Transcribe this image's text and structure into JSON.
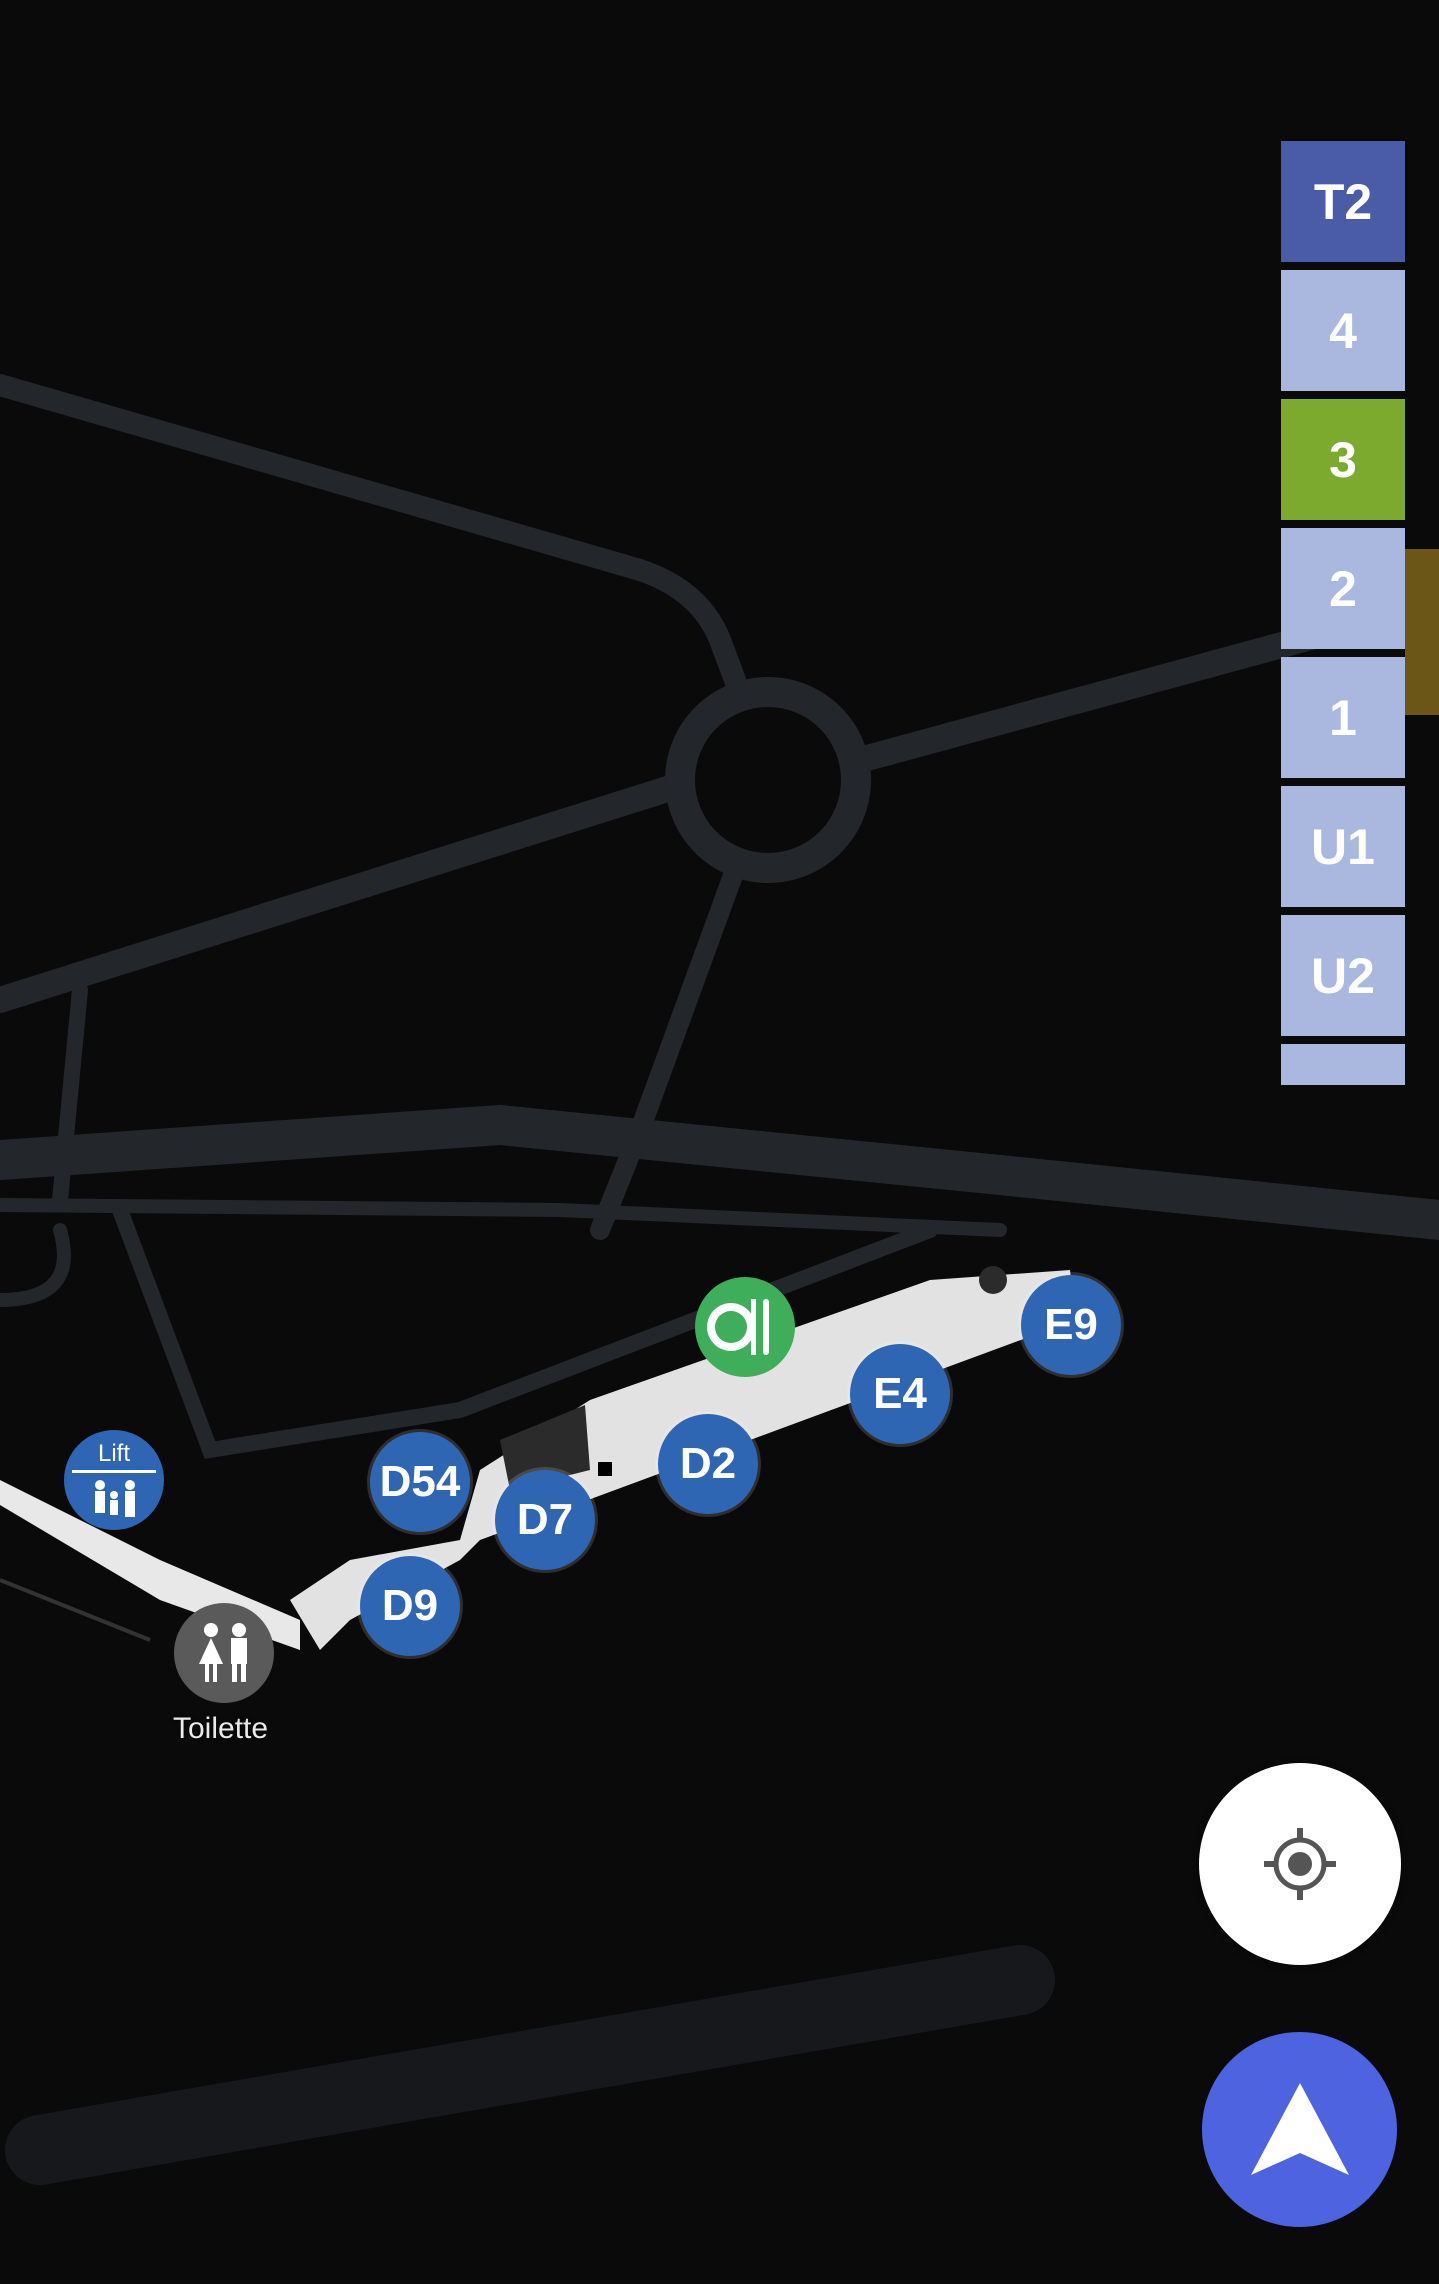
{
  "map": {
    "pois": [
      {
        "id": "lift",
        "label": "Lift",
        "icon": "lift-icon"
      },
      {
        "id": "toilet",
        "label": "Toilette",
        "icon": "toilet-icon"
      },
      {
        "id": "restaurant",
        "icon": "restaurant-icon"
      }
    ],
    "gates": [
      {
        "label": "D54"
      },
      {
        "label": "D7"
      },
      {
        "label": "D9"
      },
      {
        "label": "D2"
      },
      {
        "label": "E4"
      },
      {
        "label": "E9"
      }
    ]
  },
  "floor_selector": {
    "building": "T2",
    "floors": [
      "4",
      "3",
      "2",
      "1",
      "U1",
      "U2"
    ],
    "active_floor": "3"
  },
  "controls": {
    "locate_icon": "locate-icon",
    "navigate_icon": "navigation-arrow-icon"
  },
  "colors": {
    "gate_marker": "#2f66b3",
    "active_floor": "#7caa2f",
    "building_button": "#4a5ca8",
    "floor_button": "#aab8df",
    "navigate_button": "#4d63e0"
  }
}
